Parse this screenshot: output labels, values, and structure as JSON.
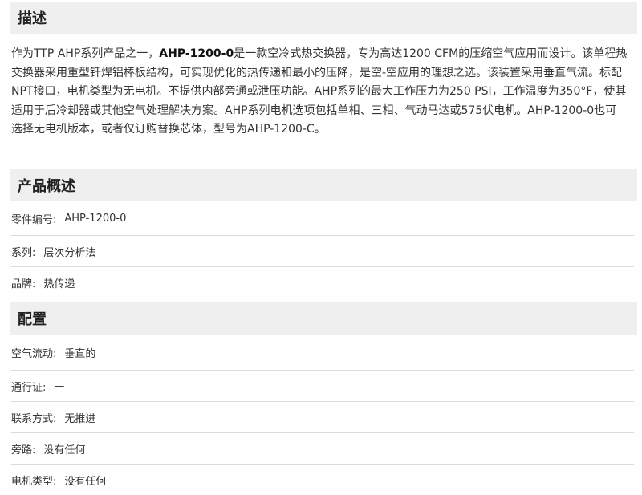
{
  "description": {
    "title": "描述",
    "text_before": "作为TTP AHP系列产品之一，",
    "model_bold": "AHP-1200-0",
    "text_after": "是一款空冷式热交换器，专为高达1200 CFM的压缩空气应用而设计。该单程热交换器采用重型钎焊铝棒板结构，可实现优化的热传递和最小的压降，是空-空应用的理想之选。该装置采用垂直气流。标配NPT接口，电机类型为无电机。不提供内部旁通或泄压功能。AHP系列的最大工作压力为250 PSI，工作温度为350°F，使其适用于后冷却器或其他空气处理解决方案。AHP系列电机选项包括单相、三相、气动马达或575伏电机。AHP-1200-0也可选择无电机版本，或者仅订购替换芯体，型号为AHP-1200-C。"
  },
  "overview": {
    "title": "产品概述",
    "rows": [
      {
        "label": "零件编号:",
        "value": "AHP-1200-0"
      },
      {
        "label": "系列:",
        "value": "层次分析法"
      },
      {
        "label": "品牌:",
        "value": "热传递"
      }
    ]
  },
  "config": {
    "title": "配置",
    "rows": [
      {
        "label": "空气流动:",
        "value": "垂直的"
      },
      {
        "label": "通行证:",
        "value": "—"
      },
      {
        "label": "联系方式:",
        "value": "无推进"
      },
      {
        "label": "旁路:",
        "value": "没有任何"
      },
      {
        "label": "电机类型:",
        "value": "没有任何"
      }
    ]
  }
}
